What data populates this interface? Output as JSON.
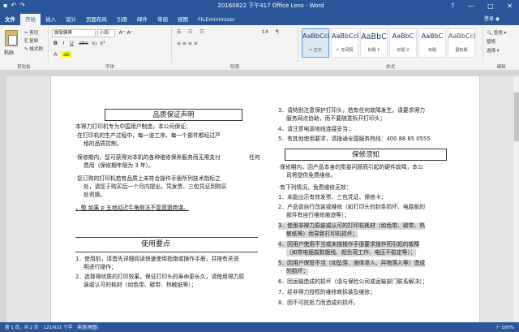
{
  "title_bar": {
    "title": "20160822 下午417 Office Lens - Word",
    "undo": "↶",
    "redo": "↷",
    "save": "▪",
    "help": "?",
    "minimize": "—",
    "maximize": "□",
    "close": "✕"
  },
  "tabs": [
    "文件",
    "开始",
    "插入",
    "设计",
    "页面布局",
    "引用",
    "邮件",
    "审阅",
    "视图",
    "FILEminimizer"
  ],
  "active_tab": "开始",
  "signin": "登录 ◉",
  "ribbon": {
    "clipboard": {
      "paste": "粘贴",
      "cut": "✂ 剪切",
      "copy": "⎘ 复制",
      "format_painter": "✎ 格式刷",
      "label": "剪贴板"
    },
    "font": {
      "name": "微软雅黑",
      "size": "小四",
      "bold": "B",
      "italic": "I",
      "underline": "U",
      "strike": "abc",
      "sub": "x₂",
      "sup": "x²",
      "grow": "A⁺",
      "shrink": "A⁻",
      "color": "A",
      "highlight": "ab",
      "label": "字体"
    },
    "paragraph": {
      "bullets": "☰",
      "numbers": "☷",
      "multilevel": "☶",
      "align": "≡ ≡ ≡ ≡",
      "sort": "↕A",
      "marks": "¶",
      "label": "段落"
    },
    "styles": [
      {
        "sample": "AaBbCcI",
        "name": "↵ 正文"
      },
      {
        "sample": "AaBbCcI",
        "name": "↵ 无间隔"
      },
      {
        "sample": "AaBbC",
        "name": "标题 1"
      },
      {
        "sample": "AaBbC",
        "name": "标题 2"
      },
      {
        "sample": "AaBbC",
        "name": "标题"
      },
      {
        "sample": "AaBbCcI",
        "name": "副标题"
      }
    ],
    "styles_label": "样式",
    "editing": {
      "find": "🔍 查找 ▾",
      "replace": "替换",
      "select": "选择 ▾",
      "label": "编辑"
    }
  },
  "document": {
    "left_box1": "品质保证声明",
    "left_intro": "本得力打印机专为中国用户制造，本公司保证：",
    "left_lines": [
      "·在打印机的生产过程中，每一道工序，每一个部件都经过严",
      "格的品质控制。",
      "·保修期内，您可获得对本机的各种维修保养服务而无需支付",
      "费用（保修期年限为 3 年）。",
      "·您订购的打印机若有品质上未符合操作手册所列技术指标之",
      "处，请您于购买后一个月内提出，凭发票、三包凭证到购买",
      "处退换。",
      "，敬 如果 p 五地延迟牛角努法不壹遗遗商谋。"
    ],
    "left_aside": "任何",
    "left_box2": "使用要点",
    "left_use": [
      "1．使用前，请首先详细阅读快速使用指南或操作手册，并按有关说",
      "明进行操作；",
      "2．选择得优质的打印效果，保证打印头的寿命更长久，请使用得力原",
      "装或认可的耗材（如色带、碳带、热敏纸等）；"
    ],
    "right_top": [
      "3．请特别注意保护打印头，若有任何故障发生，请要求得力",
      "服务网点协助，而不要随意拆开打印头；",
      "4．请注意电源地线连接妥当；",
      "5．有其他使用要求，请拨通全国服务热线：400 88 85 0555"
    ],
    "right_box": "保修须知",
    "right_warranty": [
      "·保修期内，因产品本身的质量问题而引起的硬件故障，本公",
      "司将提供免费维修。",
      "·有下列情况，免费维修无效：",
      "1．未能出示有效发票、三包凭证、保修卡；",
      "2．产品曾自行改装或维修（如打印头的封条损坏、电路板的",
      "部件有自行维修痕迹等）；",
      "3．使用非得力原装或认可的打印机耗材（如色带、碳带、热",
      "敏纸等）而导致打印机损坏；",
      "4．因用户使用不当或未按操作手册要求操作而引起的故障",
      "（如带电插拔数据线、超负荷工作、电压不稳定等）；",
      "5．因用户保管不当（如坠落、液体渗入、异物落入等）造成",
      "的损坏；",
      "6．因运输造成的损坏（请与保险公司或运输部门联系解决）；",
      "7．经非得力授权的维修商拆装及维修；",
      "8．因不可抗拒力而造成的损坏。"
    ]
  },
  "status": {
    "page": "第 1 页，共 2 页",
    "words": "121/621 个字",
    "lang": "英语(美国)",
    "zoom": "＋ 100%"
  }
}
